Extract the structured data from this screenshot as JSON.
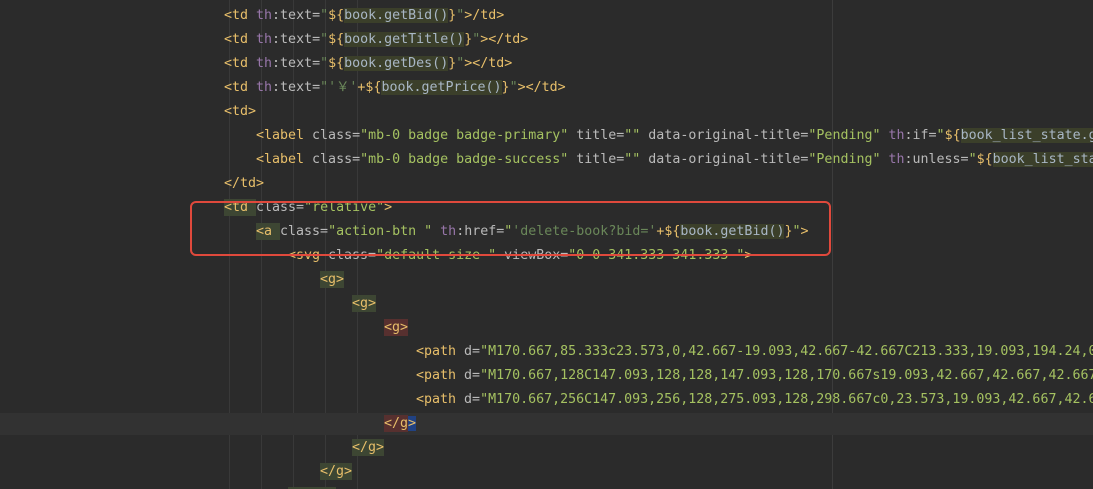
{
  "editor": {
    "lines": [
      {
        "indent": 224,
        "parts": [
          {
            "t": "<td ",
            "c": "tag"
          },
          {
            "t": "th",
            "c": "thns"
          },
          {
            "t": ":text=",
            "c": "attr"
          },
          {
            "t": "\"",
            "c": "str"
          },
          {
            "t": "${",
            "c": "tag"
          },
          {
            "t": "book.getBid()",
            "c": "expr"
          },
          {
            "t": "}",
            "c": "tag"
          },
          {
            "t": "\"",
            "c": "str"
          },
          {
            "t": ">/td>",
            "c": "tag"
          }
        ]
      },
      {
        "indent": 224,
        "parts": [
          {
            "t": "<td ",
            "c": "tag"
          },
          {
            "t": "th",
            "c": "thns"
          },
          {
            "t": ":text=",
            "c": "attr"
          },
          {
            "t": "\"",
            "c": "str"
          },
          {
            "t": "${",
            "c": "tag"
          },
          {
            "t": "book.getTitle()",
            "c": "expr"
          },
          {
            "t": "}",
            "c": "tag"
          },
          {
            "t": "\"",
            "c": "str"
          },
          {
            "t": "></td>",
            "c": "tag"
          }
        ]
      },
      {
        "indent": 224,
        "parts": [
          {
            "t": "<td ",
            "c": "tag"
          },
          {
            "t": "th",
            "c": "thns"
          },
          {
            "t": ":text=",
            "c": "attr"
          },
          {
            "t": "\"",
            "c": "str"
          },
          {
            "t": "${",
            "c": "tag"
          },
          {
            "t": "book.getDes()",
            "c": "expr"
          },
          {
            "t": "}",
            "c": "tag"
          },
          {
            "t": "\"",
            "c": "str"
          },
          {
            "t": "></td>",
            "c": "tag"
          }
        ]
      },
      {
        "indent": 224,
        "parts": [
          {
            "t": "<td ",
            "c": "tag"
          },
          {
            "t": "th",
            "c": "thns"
          },
          {
            "t": ":text=",
            "c": "attr"
          },
          {
            "t": "\"'￥'",
            "c": "str"
          },
          {
            "t": "+${",
            "c": "tag"
          },
          {
            "t": "book.getPrice()",
            "c": "expr"
          },
          {
            "t": "}",
            "c": "tag"
          },
          {
            "t": "\"",
            "c": "str"
          },
          {
            "t": "></td>",
            "c": "tag"
          }
        ]
      },
      {
        "indent": 224,
        "parts": [
          {
            "t": "<td>",
            "c": "tag"
          }
        ]
      },
      {
        "indent": 256,
        "parts": [
          {
            "t": "<label ",
            "c": "tag"
          },
          {
            "t": "class=",
            "c": "attr"
          },
          {
            "t": "\"mb-0 badge badge-primary\"",
            "c": "strg"
          },
          {
            "t": " title=",
            "c": "attr"
          },
          {
            "t": "\"\"",
            "c": "strg"
          },
          {
            "t": " data-original-title=",
            "c": "attr"
          },
          {
            "t": "\"Pending\"",
            "c": "strg"
          },
          {
            "t": " th",
            "c": "thns"
          },
          {
            "t": ":if=",
            "c": "attr"
          },
          {
            "t": "\"",
            "c": "strg"
          },
          {
            "t": "${",
            "c": "tag"
          },
          {
            "t": "book_list_state.g",
            "c": "expr"
          }
        ]
      },
      {
        "indent": 256,
        "parts": [
          {
            "t": "<label ",
            "c": "tag"
          },
          {
            "t": "class=",
            "c": "attr"
          },
          {
            "t": "\"mb-0 badge badge-success\"",
            "c": "strg"
          },
          {
            "t": " title=",
            "c": "attr"
          },
          {
            "t": "\"\"",
            "c": "strg"
          },
          {
            "t": " data-original-title=",
            "c": "attr"
          },
          {
            "t": "\"Pending\"",
            "c": "strg"
          },
          {
            "t": " th",
            "c": "thns"
          },
          {
            "t": ":unless=",
            "c": "attr"
          },
          {
            "t": "\"",
            "c": "strg"
          },
          {
            "t": "${",
            "c": "tag"
          },
          {
            "t": "book_list_sta",
            "c": "expr"
          }
        ]
      },
      {
        "indent": 224,
        "parts": [
          {
            "t": "</td>",
            "c": "tag"
          }
        ]
      },
      {
        "indent": 224,
        "parts": [
          {
            "t": "<td ",
            "c": "ttag"
          },
          {
            "t": "class=",
            "c": "attr"
          },
          {
            "t": "\"relative\"",
            "c": "strg"
          },
          {
            "t": ">",
            "c": "tag"
          }
        ]
      },
      {
        "indent": 256,
        "parts": [
          {
            "t": "<a ",
            "c": "ttag"
          },
          {
            "t": "class=",
            "c": "attr"
          },
          {
            "t": "\"action-btn \"",
            "c": "strg"
          },
          {
            "t": " th",
            "c": "thns"
          },
          {
            "t": ":href=",
            "c": "attr"
          },
          {
            "t": "\"",
            "c": "strg"
          },
          {
            "t": "'delete-book?bid='",
            "c": "str"
          },
          {
            "t": "+${",
            "c": "tag"
          },
          {
            "t": "book.getBid()",
            "c": "expr"
          },
          {
            "t": "}",
            "c": "tag"
          },
          {
            "t": "\"",
            "c": "strg"
          },
          {
            "t": ">",
            "c": "tag"
          }
        ]
      },
      {
        "indent": 288,
        "strike": true,
        "parts": [
          {
            "t": "<svg ",
            "c": "tag"
          },
          {
            "t": "class=",
            "c": "attr"
          },
          {
            "t": "\"default-size \"",
            "c": "strg"
          },
          {
            "t": " viewBox=",
            "c": "attr"
          },
          {
            "t": "\"0 0 341.333 341.333 \"",
            "c": "strg"
          },
          {
            "t": ">",
            "c": "tag"
          }
        ]
      },
      {
        "indent": 320,
        "parts": [
          {
            "t": "<g>",
            "c": "ttag"
          }
        ]
      },
      {
        "indent": 352,
        "parts": [
          {
            "t": "<g>",
            "c": "ttag"
          }
        ]
      },
      {
        "indent": 384,
        "parts": [
          {
            "t": "<g>",
            "c": "ttag2"
          }
        ]
      },
      {
        "indent": 416,
        "parts": [
          {
            "t": "<path ",
            "c": "tag"
          },
          {
            "t": "d=",
            "c": "attr"
          },
          {
            "t": "\"M170.667,85.333c23.573,0,42.667-19.093,42.667-42.667C213.333,19.093,194.24,0",
            "c": "strg"
          }
        ]
      },
      {
        "indent": 416,
        "parts": [
          {
            "t": "<path ",
            "c": "tag"
          },
          {
            "t": "d=",
            "c": "attr"
          },
          {
            "t": "\"M170.667,128C147.093,128,128,147.093,128,170.667s19.093,42.667,42.667,42.667",
            "c": "strg"
          }
        ]
      },
      {
        "indent": 416,
        "parts": [
          {
            "t": "<path ",
            "c": "tag"
          },
          {
            "t": "d=",
            "c": "attr"
          },
          {
            "t": "\"M170.667,256C147.093,256,128,275.093,128,298.667c0,23.573,19.093,42.667,42.6",
            "c": "strg"
          }
        ]
      },
      {
        "indent": 384,
        "parts": [
          {
            "t": "</g",
            "c": "ttag2"
          },
          {
            "t": ">",
            "c": "cur"
          }
        ]
      },
      {
        "indent": 352,
        "parts": [
          {
            "t": "</g>",
            "c": "ttag"
          }
        ]
      },
      {
        "indent": 320,
        "parts": [
          {
            "t": "</g>",
            "c": "ttag"
          }
        ]
      },
      {
        "indent": 288,
        "parts": [
          {
            "t": "</svg>",
            "c": "ttag"
          }
        ]
      }
    ]
  }
}
